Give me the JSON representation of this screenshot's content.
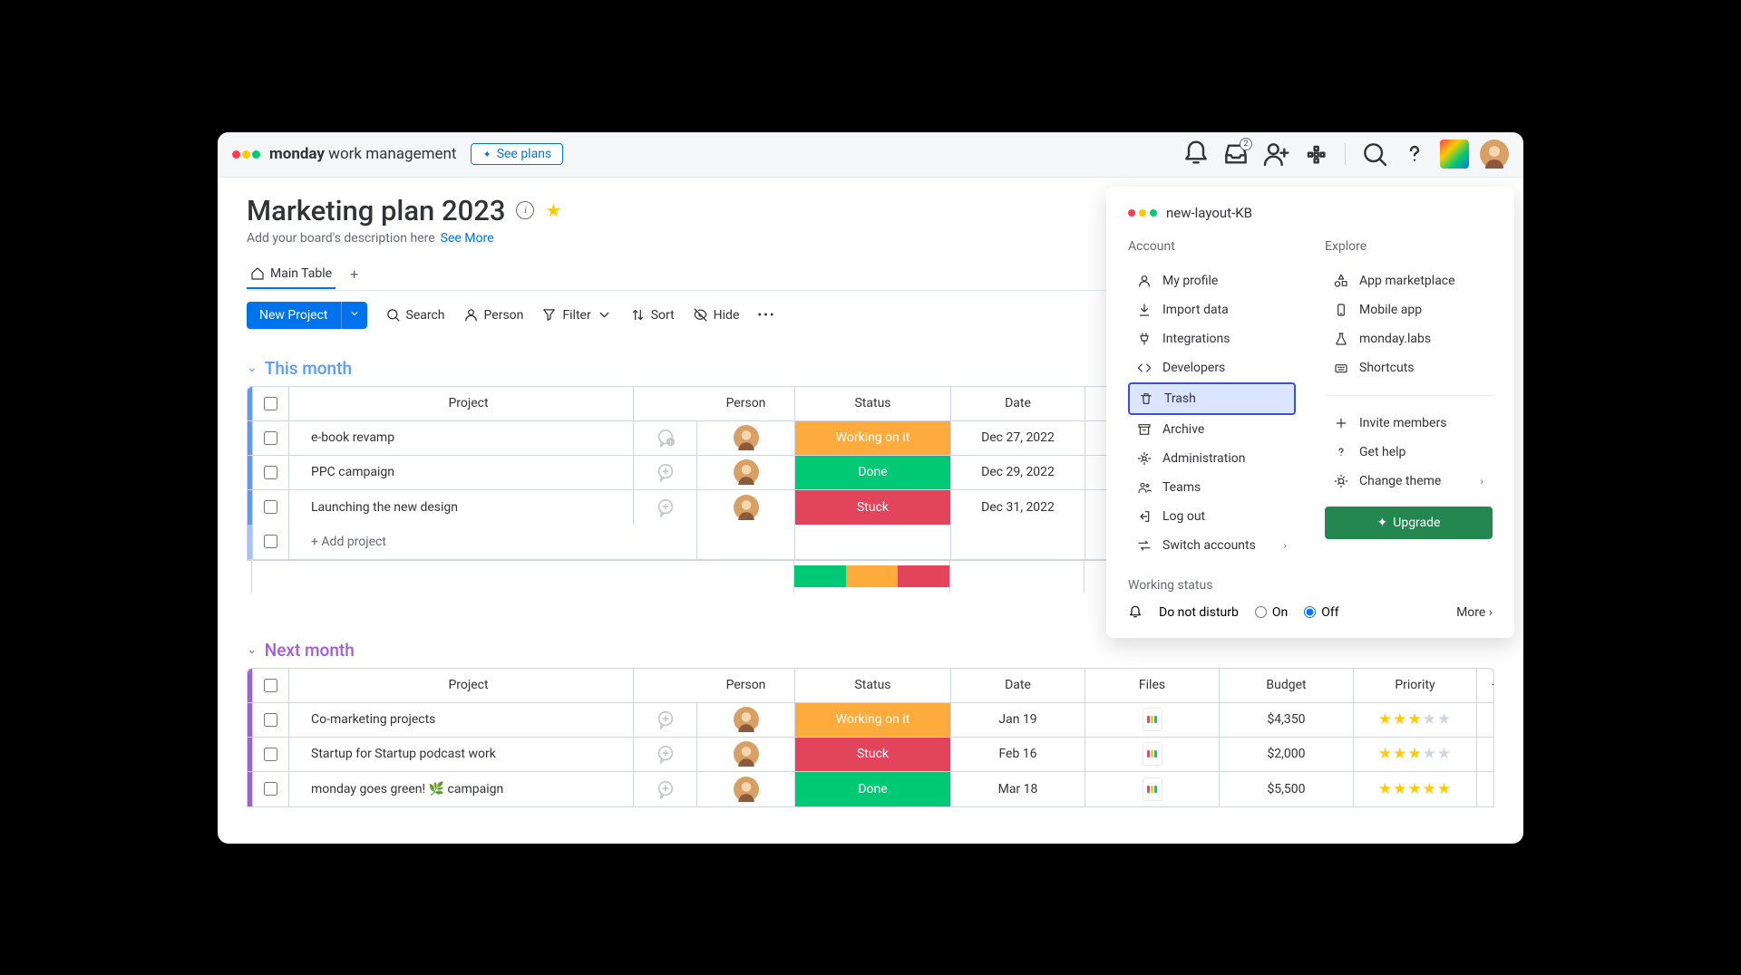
{
  "header": {
    "brand_bold": "monday",
    "brand_rest": " work management",
    "see_plans": "See plans",
    "inbox_badge": "2"
  },
  "board": {
    "title": "Marketing plan 2023",
    "description": "Add your board's description here",
    "see_more": "See More",
    "tab": "Main Table"
  },
  "toolbar": {
    "new_project": "New Project",
    "search": "Search",
    "person": "Person",
    "filter": "Filter",
    "sort": "Sort",
    "hide": "Hide"
  },
  "group1": {
    "name": "This month",
    "color": "#579bfc",
    "cols": {
      "project": "Project",
      "person": "Person",
      "status": "Status",
      "date": "Date"
    },
    "rows": [
      {
        "project": "e-book revamp",
        "status": "Working on it",
        "status_cls": "s-working",
        "date": "Dec 27, 2022"
      },
      {
        "project": "PPC campaign",
        "status": "Done",
        "status_cls": "s-done",
        "date": "Dec 29, 2022"
      },
      {
        "project": "Launching the new design",
        "status": "Stuck",
        "status_cls": "s-stuck",
        "date": "Dec 31, 2022"
      }
    ],
    "add": "+ Add project"
  },
  "group2": {
    "name": "Next month",
    "color": "#a25ddc",
    "cols": {
      "project": "Project",
      "person": "Person",
      "status": "Status",
      "date": "Date",
      "files": "Files",
      "budget": "Budget",
      "priority": "Priority"
    },
    "rows": [
      {
        "project": "Co-marketing projects",
        "status": "Working on it",
        "status_cls": "s-working",
        "date": "Jan 19",
        "budget": "$4,350",
        "stars": 3
      },
      {
        "project": "Startup for Startup podcast work",
        "status": "Stuck",
        "status_cls": "s-stuck",
        "date": "Feb 16",
        "budget": "$2,000",
        "stars": 3
      },
      {
        "project": "monday goes green! 🌿 campaign",
        "status": "Done",
        "status_cls": "s-done",
        "date": "Mar 18",
        "budget": "$5,500",
        "stars": 5
      }
    ]
  },
  "dropdown": {
    "workspace": "new-layout-KB",
    "account_title": "Account",
    "explore_title": "Explore",
    "account": [
      {
        "label": "My profile",
        "icon": "user"
      },
      {
        "label": "Import data",
        "icon": "download"
      },
      {
        "label": "Integrations",
        "icon": "plug"
      },
      {
        "label": "Developers",
        "icon": "code"
      },
      {
        "label": "Trash",
        "icon": "trash",
        "highlight": true
      },
      {
        "label": "Archive",
        "icon": "archive"
      },
      {
        "label": "Administration",
        "icon": "gear"
      },
      {
        "label": "Teams",
        "icon": "team"
      },
      {
        "label": "Log out",
        "icon": "logout"
      },
      {
        "label": "Switch accounts",
        "icon": "switch",
        "arrow": true
      }
    ],
    "explore": [
      {
        "label": "App marketplace",
        "icon": "shapes"
      },
      {
        "label": "Mobile app",
        "icon": "mobile"
      },
      {
        "label": "monday.labs",
        "icon": "flask"
      },
      {
        "label": "Shortcuts",
        "icon": "keys"
      }
    ],
    "actions": [
      {
        "label": "Invite members",
        "icon": "plus"
      },
      {
        "label": "Get help",
        "icon": "help"
      },
      {
        "label": "Change theme",
        "icon": "sun",
        "arrow": true
      }
    ],
    "upgrade": "Upgrade",
    "working_status_title": "Working status",
    "dnd": "Do not disturb",
    "on": "On",
    "off": "Off",
    "more": "More"
  }
}
